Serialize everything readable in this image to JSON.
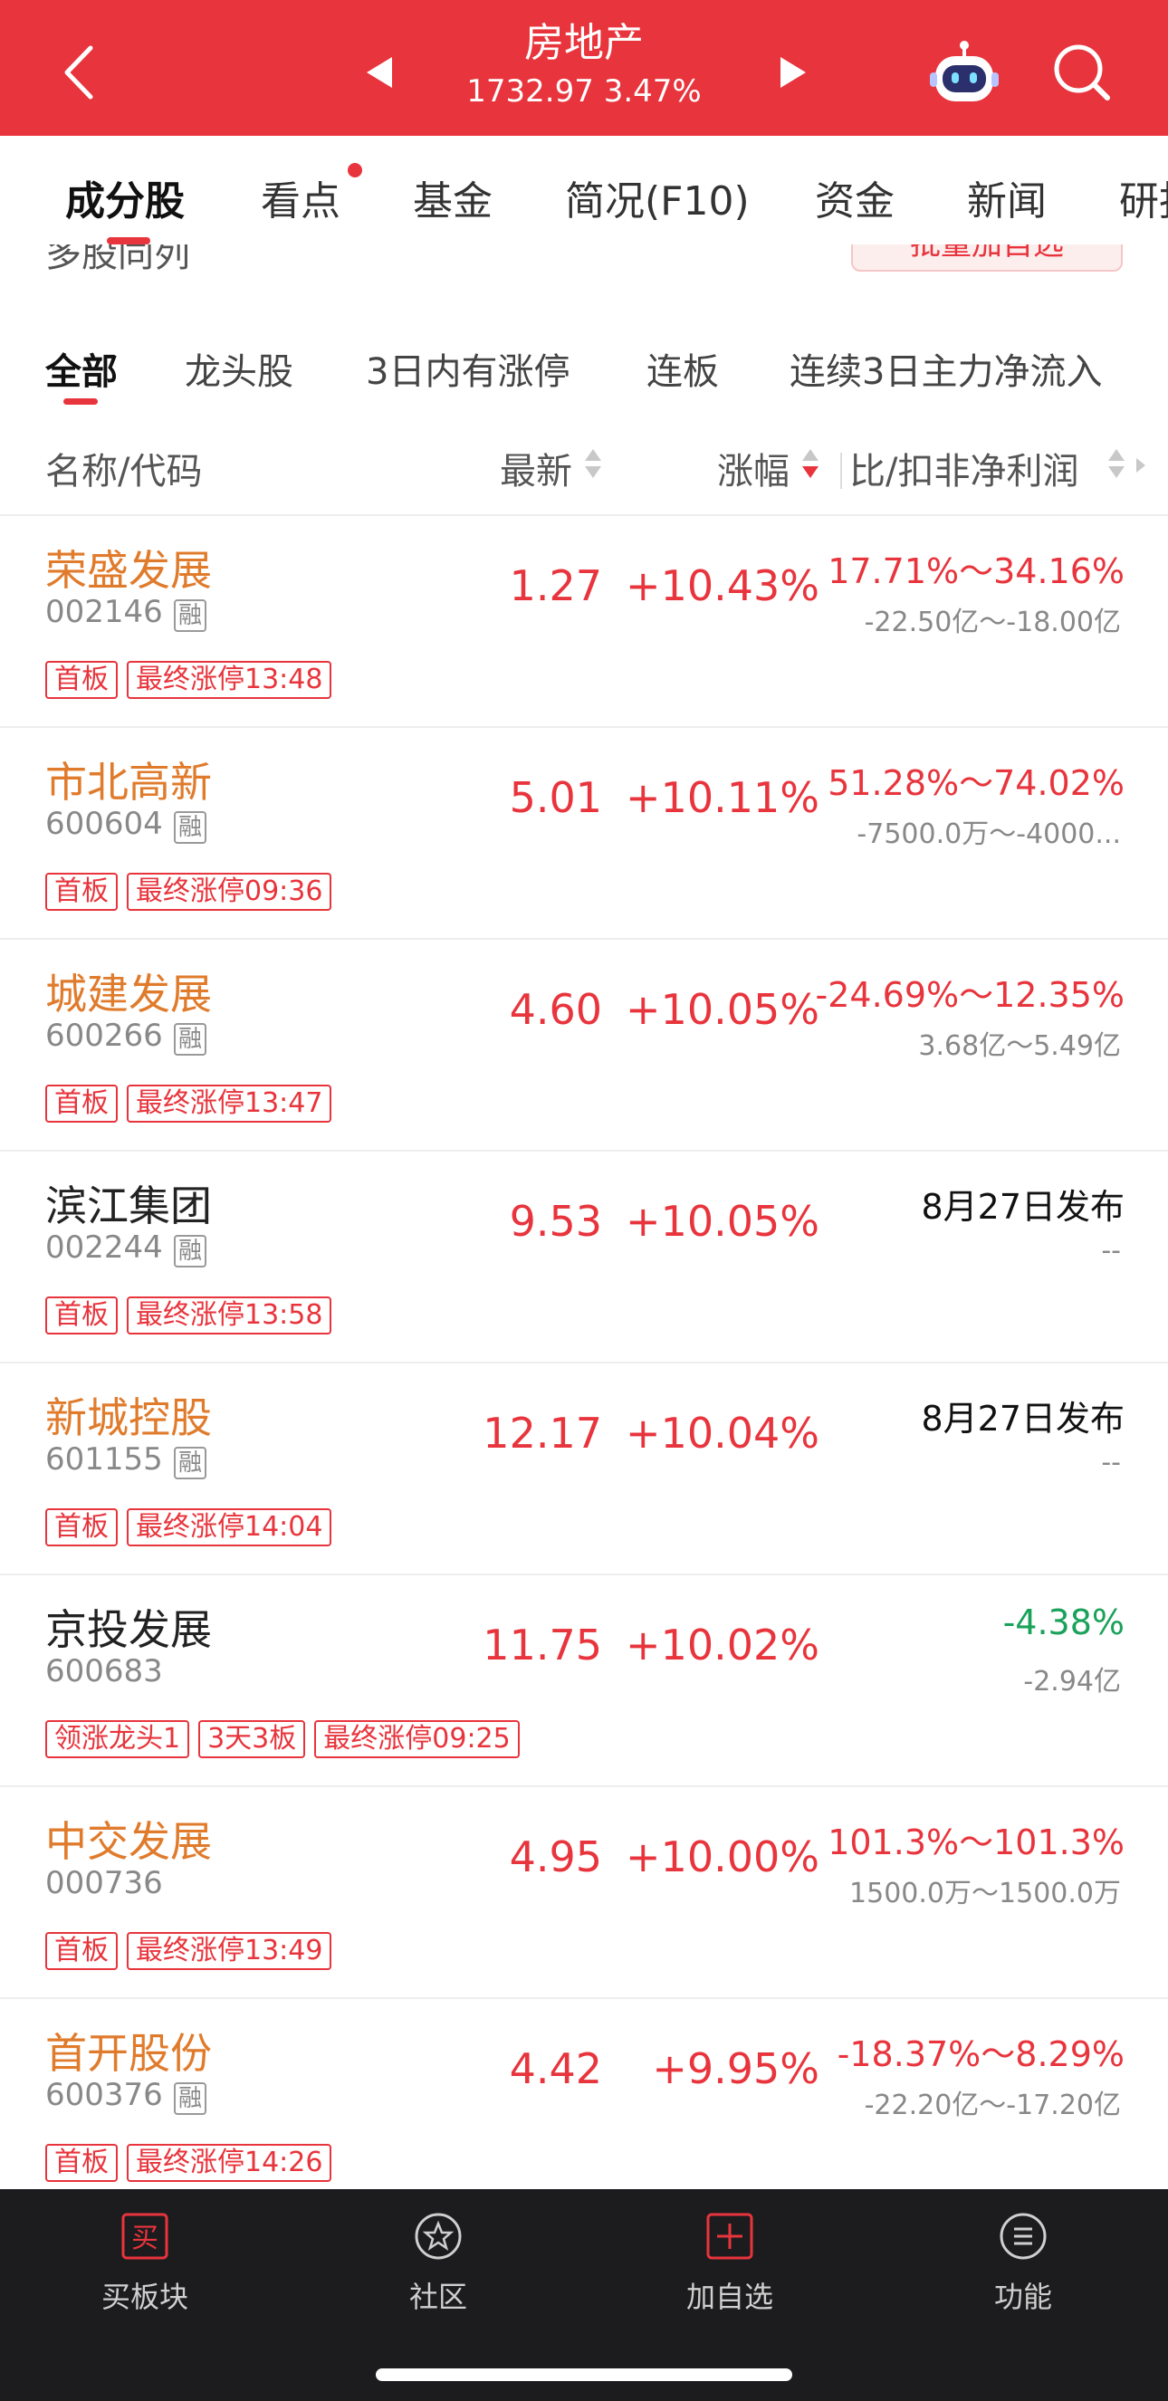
{
  "header": {
    "title": "房地产",
    "index_value": "1732.97",
    "index_change": "3.47%",
    "color": "#e8343c"
  },
  "main_tabs": [
    {
      "label": "成分股",
      "active": true
    },
    {
      "label": "看点",
      "has_dot": true
    },
    {
      "label": "基金"
    },
    {
      "label": "简况(F10)"
    },
    {
      "label": "资金"
    },
    {
      "label": "新闻"
    },
    {
      "label": "研报"
    }
  ],
  "toolbar": {
    "multi_compare": "多股同列",
    "batch_add": "批量加自选"
  },
  "filter_tabs": [
    {
      "label": "全部",
      "active": true
    },
    {
      "label": "龙头股"
    },
    {
      "label": "3日内有涨停"
    },
    {
      "label": "连板"
    },
    {
      "label": "连续3日主力净流入"
    }
  ],
  "columns": {
    "name_code": "名称/代码",
    "latest": "最新",
    "change": "涨幅",
    "profit": "比/扣非净利润"
  },
  "tag_badge": "融",
  "stocks": [
    {
      "name": "荣盛发展",
      "code": "002146",
      "rong": true,
      "price": "1.27",
      "change": "+10.43%",
      "profit_main": "17.71%～34.16%",
      "profit_sub": "-22.50亿～-18.00亿",
      "tags": [
        "首板",
        "最终涨停13:48"
      ],
      "name_color": "#e07b2c",
      "profit_color": "#e8343c"
    },
    {
      "name": "市北高新",
      "code": "600604",
      "rong": true,
      "price": "5.01",
      "change": "+10.11%",
      "profit_main": "51.28%～74.02%",
      "profit_sub": "-7500.0万～-4000...",
      "tags": [
        "首板",
        "最终涨停09:36"
      ],
      "name_color": "#e07b2c",
      "profit_color": "#e8343c"
    },
    {
      "name": "城建发展",
      "code": "600266",
      "rong": true,
      "price": "4.60",
      "change": "+10.05%",
      "profit_main": "-24.69%～12.35%",
      "profit_sub": "3.68亿～5.49亿",
      "tags": [
        "首板",
        "最终涨停13:47"
      ],
      "name_color": "#e07b2c",
      "profit_color": "#e8343c"
    },
    {
      "name": "滨江集团",
      "code": "002244",
      "rong": true,
      "price": "9.53",
      "change": "+10.05%",
      "profit_main": "8月27日发布",
      "profit_sub": "--",
      "tags": [
        "首板",
        "最终涨停13:58"
      ],
      "name_color": "#222222",
      "profit_color": "#111111"
    },
    {
      "name": "新城控股",
      "code": "601155",
      "rong": true,
      "price": "12.17",
      "change": "+10.04%",
      "profit_main": "8月27日发布",
      "profit_sub": "--",
      "tags": [
        "首板",
        "最终涨停14:04"
      ],
      "name_color": "#e07b2c",
      "profit_color": "#111111"
    },
    {
      "name": "京投发展",
      "code": "600683",
      "rong": false,
      "price": "11.75",
      "change": "+10.02%",
      "profit_main": "-4.38%",
      "profit_sub": "-2.94亿",
      "tags": [
        "领涨龙头1",
        "3天3板",
        "最终涨停09:25"
      ],
      "name_color": "#222222",
      "profit_color": "#1aa15a"
    },
    {
      "name": "中交发展",
      "code": "000736",
      "rong": false,
      "price": "4.95",
      "change": "+10.00%",
      "profit_main": "101.3%～101.3%",
      "profit_sub": "1500.0万～1500.0万",
      "tags": [
        "首板",
        "最终涨停13:49"
      ],
      "name_color": "#e07b2c",
      "profit_color": "#e8343c"
    },
    {
      "name": "首开股份",
      "code": "600376",
      "rong": true,
      "price": "4.42",
      "change": "+9.95%",
      "profit_main": "-18.37%～8.29%",
      "profit_sub": "-22.20亿～-17.20亿",
      "tags": [
        "首板",
        "最终涨停14:26"
      ],
      "name_color": "#e07b2c",
      "profit_color": "#e8343c"
    }
  ],
  "bottom_nav": [
    {
      "label": "买板块",
      "icon": "buy-icon"
    },
    {
      "label": "社区",
      "icon": "community-icon"
    },
    {
      "label": "加自选",
      "icon": "add-watchlist-icon"
    },
    {
      "label": "功能",
      "icon": "menu-icon"
    }
  ]
}
